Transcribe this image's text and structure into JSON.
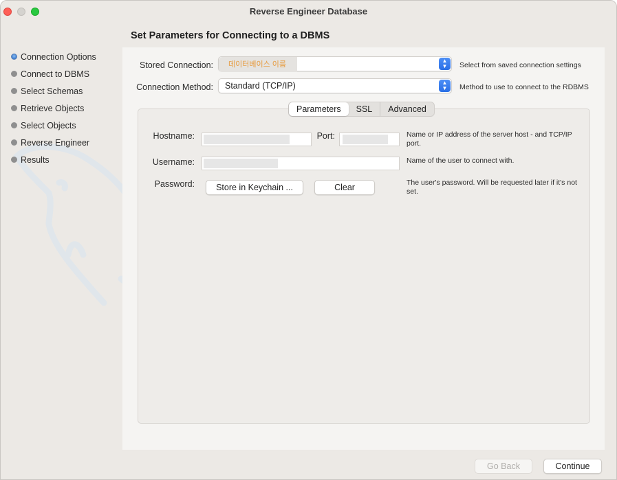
{
  "window": {
    "title": "Reverse Engineer Database"
  },
  "page": {
    "heading": "Set Parameters for Connecting to a DBMS"
  },
  "steps": [
    {
      "label": "Connection Options",
      "active": true
    },
    {
      "label": "Connect to DBMS",
      "active": false
    },
    {
      "label": "Select Schemas",
      "active": false
    },
    {
      "label": "Retrieve Objects",
      "active": false
    },
    {
      "label": "Select Objects",
      "active": false
    },
    {
      "label": "Reverse Engineer",
      "active": false
    },
    {
      "label": "Results",
      "active": false
    }
  ],
  "stored_connection": {
    "label": "Stored Connection:",
    "value": "데이터베이스 이름",
    "hint": "Select from saved connection settings"
  },
  "connection_method": {
    "label": "Connection Method:",
    "value": "Standard (TCP/IP)",
    "hint": "Method to use to connect to the RDBMS"
  },
  "tabs": [
    "Parameters",
    "SSL",
    "Advanced"
  ],
  "params": {
    "hostname_label": "Hostname:",
    "port_label": "Port:",
    "hostname_hint": "Name or IP address of the server host - and TCP/IP port.",
    "username_label": "Username:",
    "username_hint": "Name of the user to connect with.",
    "password_label": "Password:",
    "store_keychain": "Store in Keychain ...",
    "clear": "Clear",
    "password_hint": "The user's password. Will be requested later if it's not set."
  },
  "footer": {
    "go_back": "Go Back",
    "continue": "Continue"
  },
  "colors": {
    "accent": "#2a6fe6",
    "db_name_text": "#e79b3f"
  }
}
